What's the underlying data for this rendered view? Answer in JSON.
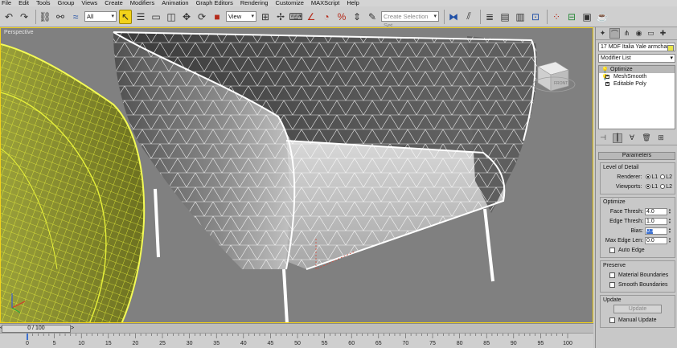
{
  "menu": [
    "File",
    "Edit",
    "Tools",
    "Group",
    "Views",
    "Create",
    "Modifiers",
    "Animation",
    "Graph Editors",
    "Rendering",
    "Customize",
    "MAXScript",
    "Help"
  ],
  "toolbar": {
    "selection_filter": "All",
    "reference_coord": "View",
    "named_selection_placeholder": "Create Selection Set"
  },
  "viewport": {
    "label": "Perspective",
    "viewcube_face": "FRONT"
  },
  "command_panel": {
    "object_name": "17 MDF Italia Yale armchair",
    "object_color": "#e8e54a",
    "modifier_list": "Modifier List",
    "stack": [
      {
        "label": "Optimize",
        "selected": true
      },
      {
        "label": "MeshSmooth",
        "selected": false
      },
      {
        "label": "Editable Poly",
        "selected": false
      }
    ],
    "parameters": {
      "title": "Parameters",
      "level_of_detail": {
        "title": "Level of Detail",
        "renderer_label": "Renderer:",
        "viewports_label": "Viewports:",
        "l1": "L1",
        "l2": "L2"
      },
      "optimize": {
        "title": "Optimize",
        "face_thresh_label": "Face Thresh:",
        "face_thresh": "4.0",
        "edge_thresh_label": "Edge Thresh:",
        "edge_thresh": "1.0",
        "bias_label": "Bias:",
        "bias": "0.1",
        "max_edge_len_label": "Max Edge Len:",
        "max_edge_len": "0.0",
        "auto_edge": "Auto Edge"
      },
      "preserve": {
        "title": "Preserve",
        "material_boundaries": "Material Boundaries",
        "smooth_boundaries": "Smooth Boundaries"
      },
      "update": {
        "title": "Update",
        "update_button": "Update",
        "manual_update": "Manual Update"
      }
    }
  },
  "time_slider": {
    "frame_display": "0 / 100",
    "current_frame": 0,
    "total_frames": 100
  },
  "trackbar": {
    "ticks": [
      "0",
      "5",
      "10",
      "15",
      "20",
      "25",
      "30",
      "35",
      "40",
      "45",
      "50",
      "55",
      "60",
      "65",
      "70",
      "75",
      "80",
      "85",
      "90",
      "95",
      "100"
    ]
  },
  "colors": {
    "active_tool": "#f2d21a",
    "viewport_bg": "#808080",
    "wire_white": "#ffffff",
    "wire_yellow": "#e6f03a"
  }
}
